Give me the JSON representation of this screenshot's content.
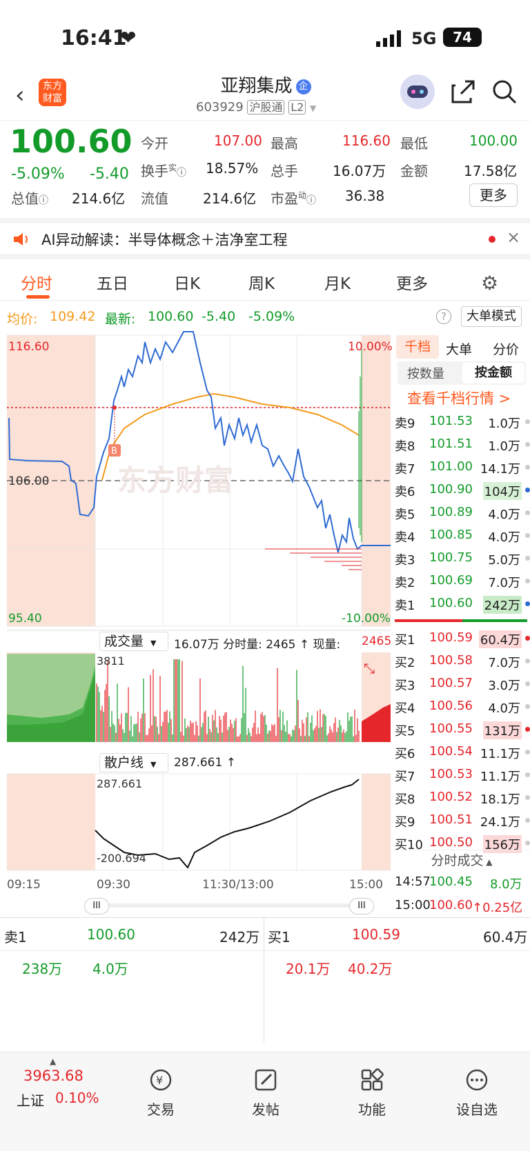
{
  "status": {
    "time": "16:41",
    "network": "5G",
    "battery": "74"
  },
  "nav": {
    "logo_line1": "东方",
    "logo_line2": "财富",
    "title": "亚翔集成",
    "badge": "企",
    "code": "603929",
    "tag1": "沪股通",
    "tag2": "L2"
  },
  "quote": {
    "price": "100.60",
    "change_pct": "-5.09%",
    "change": "-5.40",
    "open_label": "今开",
    "open": "107.00",
    "high_label": "最高",
    "high": "116.60",
    "low_label": "最低",
    "low": "100.00",
    "turnover_label": "换手",
    "turnover_sup": "实",
    "turnover": "18.57%",
    "vol_label": "总手",
    "vol": "16.07万",
    "amount_label": "金额",
    "amount": "17.58亿",
    "mcap_label": "总值",
    "mcap": "214.6亿",
    "float_label": "流值",
    "float": "214.6亿",
    "pe_label": "市盈",
    "pe_sup": "动",
    "pe": "36.38",
    "more": "更多"
  },
  "banner": {
    "text": "AI异动解读：半导体概念＋洁净室工程"
  },
  "tabs": [
    "分时",
    "五日",
    "日K",
    "周K",
    "月K",
    "更多"
  ],
  "info": {
    "avg_label": "均价:",
    "avg": "109.42",
    "latest_label": "最新:",
    "latest": "100.60",
    "chg": "-5.40",
    "pct": "-5.09%",
    "mode": "大单模式"
  },
  "chart": {
    "ymax": "116.60",
    "ymid": "106.00",
    "ymin": "95.40",
    "pmax": "10.00%",
    "pmin": "-10.00%",
    "watermark": "东方财富",
    "marker": "B",
    "vol_selector": "成交量",
    "vol_text": "16.07万 分时量: 2465 ↑ 现量:",
    "vol_now": "2465",
    "vol_max": "3811",
    "sh_selector": "散户线",
    "sh_value": "287.661 ↑",
    "sh_max": "287.661",
    "sh_min": "-200.694",
    "times": [
      "09:15",
      "09:30",
      "11:30/13:00",
      "15:00"
    ]
  },
  "chart_data": {
    "type": "line",
    "title": "",
    "series": [
      {
        "name": "最新",
        "values": []
      },
      {
        "name": "均价",
        "values": []
      }
    ],
    "ylim": [
      95.4,
      116.6
    ],
    "x": [
      "09:15",
      "09:30",
      "11:30/13:00",
      "15:00"
    ]
  },
  "book": {
    "tabs": [
      "千档",
      "大单",
      "分价"
    ],
    "subtabs": [
      "按数量",
      "按金额"
    ],
    "link": "查看千档行情 >",
    "asks": [
      [
        "卖9",
        "101.53",
        "1.0万"
      ],
      [
        "卖8",
        "101.51",
        "1.0万"
      ],
      [
        "卖7",
        "101.00",
        "14.1万"
      ],
      [
        "卖6",
        "100.90",
        "104万"
      ],
      [
        "卖5",
        "100.89",
        "4.0万"
      ],
      [
        "卖4",
        "100.85",
        "4.0万"
      ],
      [
        "卖3",
        "100.75",
        "5.0万"
      ],
      [
        "卖2",
        "100.69",
        "7.0万"
      ],
      [
        "卖1",
        "100.60",
        "242万"
      ]
    ],
    "bids": [
      [
        "买1",
        "100.59",
        "60.4万"
      ],
      [
        "买2",
        "100.58",
        "7.0万"
      ],
      [
        "买3",
        "100.57",
        "3.0万"
      ],
      [
        "买4",
        "100.56",
        "4.0万"
      ],
      [
        "买5",
        "100.55",
        "131万"
      ],
      [
        "买6",
        "100.54",
        "11.1万"
      ],
      [
        "买7",
        "100.53",
        "11.1万"
      ],
      [
        "买8",
        "100.52",
        "18.1万"
      ],
      [
        "买9",
        "100.51",
        "24.1万"
      ],
      [
        "买10",
        "100.50",
        "156万"
      ]
    ],
    "ticks_title": "分时成交",
    "ticks": [
      [
        "14:57",
        "100.45",
        "8.0万"
      ],
      [
        "15:00",
        "100.60",
        "↑0.25亿"
      ]
    ]
  },
  "level": {
    "ask_label": "卖1",
    "ask_price": "100.60",
    "ask_vol": "242万",
    "ask_q1": "238万",
    "ask_q2": "4.0万",
    "bid_label": "买1",
    "bid_price": "100.59",
    "bid_vol": "60.4万",
    "bid_q1": "20.1万",
    "bid_q2": "40.2万"
  },
  "tabbar": {
    "index_value": "3963.68",
    "index_name": "上证",
    "index_pct": "0.10%",
    "items": [
      "交易",
      "发帖",
      "功能",
      "设自选"
    ]
  }
}
